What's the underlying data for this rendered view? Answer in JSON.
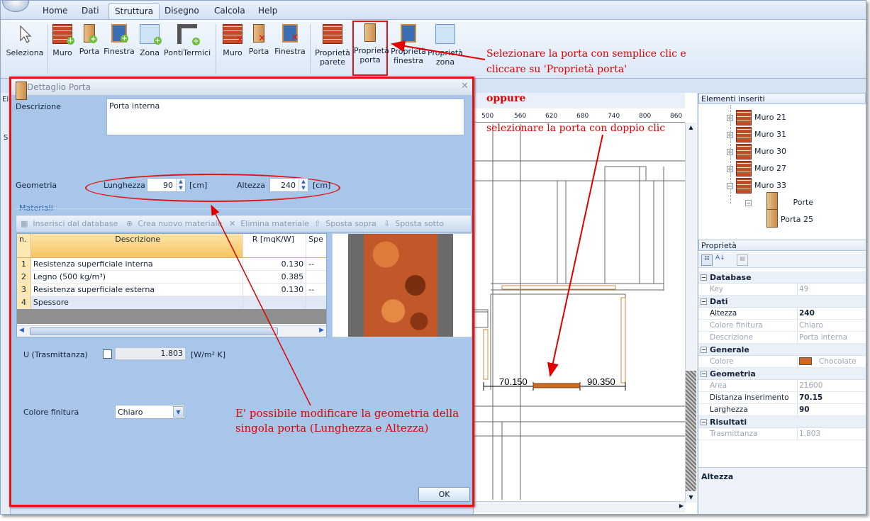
{
  "menu": {
    "items": [
      "Home",
      "Dati",
      "Struttura",
      "Disegno",
      "Calcola",
      "Help"
    ],
    "active": "Struttura"
  },
  "ribbon": {
    "insert": [
      {
        "label": "Seleziona"
      },
      {
        "label": "Muro"
      },
      {
        "label": "Porta"
      },
      {
        "label": "Finestra"
      },
      {
        "label": "Zona"
      },
      {
        "label": "PontiTermici"
      }
    ],
    "delete": [
      {
        "label": "Muro"
      },
      {
        "label": "Porta"
      },
      {
        "label": "Finestra"
      }
    ],
    "props": [
      {
        "line1": "Proprietà",
        "line2": "parete"
      },
      {
        "line1": "Proprietà",
        "line2": "porta"
      },
      {
        "line1": "Proprietà",
        "line2": "finestra"
      },
      {
        "line1": "Proprietà",
        "line2": "zona"
      }
    ]
  },
  "annotations": {
    "a1_line1": "Selezionare la porta con semplice clic e",
    "a1_line2": "cliccare su 'Proprietà porta'",
    "a2": "oppure",
    "a3": "selezionare la porta con doppio clic",
    "a4_line1": "E' possibile modificare la geometria della",
    "a4_line2": "singola porta (Lunghezza e Altezza)"
  },
  "canvas": {
    "ruler": [
      "500",
      "560",
      "620",
      "680",
      "740",
      "800",
      "860"
    ],
    "dim_left": "70.150",
    "dim_right": "90.350"
  },
  "elements_panel": {
    "title": "Elementi inseriti",
    "items": [
      {
        "label": "Muro 21",
        "toggle": "+"
      },
      {
        "label": "Muro 31",
        "toggle": "+"
      },
      {
        "label": "Muro 30",
        "toggle": "+"
      },
      {
        "label": "Muro 27",
        "toggle": "+"
      },
      {
        "label": "Muro 33",
        "toggle": "−"
      }
    ],
    "porte_label": "Porte",
    "porta_label": "Porta 25"
  },
  "properties_panel": {
    "title": "Proprietà",
    "groups": [
      {
        "name": "Database",
        "rows": [
          {
            "k": "Key",
            "v": "49",
            "disabled": true
          }
        ]
      },
      {
        "name": "Dati",
        "rows": [
          {
            "k": "Altezza",
            "v": "240",
            "disabled": false,
            "bold": true
          },
          {
            "k": "Colore finitura",
            "v": "Chiaro",
            "disabled": true
          },
          {
            "k": "Descrizione",
            "v": "Porta interna",
            "disabled": true
          }
        ]
      },
      {
        "name": "Generale",
        "rows": [
          {
            "k": "Colore",
            "v": "Chocolate",
            "disabled": true,
            "swatch": "#d2691e"
          }
        ]
      },
      {
        "name": "Geometria",
        "rows": [
          {
            "k": "Area",
            "v": "21600",
            "disabled": true
          },
          {
            "k": "Distanza inserimento",
            "v": "70.15",
            "disabled": false,
            "bold": true
          },
          {
            "k": "Larghezza",
            "v": "90",
            "disabled": false,
            "bold": true
          }
        ]
      },
      {
        "name": "Risultati",
        "rows": [
          {
            "k": "Trasmittanza",
            "v": "1.803",
            "disabled": true
          }
        ]
      }
    ],
    "help_title": "Altezza"
  },
  "dialog": {
    "title": "Dettaglio Porta",
    "descrizione_label": "Descrizione",
    "descrizione_value": "Porta interna",
    "geometria_label": "Geometria",
    "lunghezza_label": "Lunghezza",
    "lunghezza_value": "90",
    "lunghezza_unit": "[cm]",
    "altezza_label": "Altezza",
    "altezza_value": "240",
    "altezza_unit": "[cm]",
    "materiali_label": "Materiali",
    "toolbar": [
      "Inserisci dal database",
      "Crea nuovo materiale",
      "Elimina materiale",
      "Sposta sopra",
      "Sposta sotto"
    ],
    "grid_headers": {
      "n": "n.",
      "descr": "Descrizione",
      "r": "R [mqK/W]",
      "spe": "Spe"
    },
    "grid_rows": [
      {
        "n": "1",
        "descr": "Resistenza superficiale interna",
        "r": "0.130",
        "s": "--"
      },
      {
        "n": "2",
        "descr": "Legno (500 kg/m³)",
        "r": "0.385",
        "s": ""
      },
      {
        "n": "3",
        "descr": "Resistenza superficiale esterna",
        "r": "0.130",
        "s": "--"
      },
      {
        "n": "4",
        "descr": "Spessore",
        "r": "",
        "s": ""
      }
    ],
    "u_label": "U (Trasmittanza)",
    "u_value": "1.803",
    "u_unit": "[W/m² K]",
    "colore_label": "Colore finitura",
    "colore_value": "Chiaro",
    "ok_label": "OK"
  },
  "left_strip": {
    "a": "El",
    "b": "S"
  }
}
